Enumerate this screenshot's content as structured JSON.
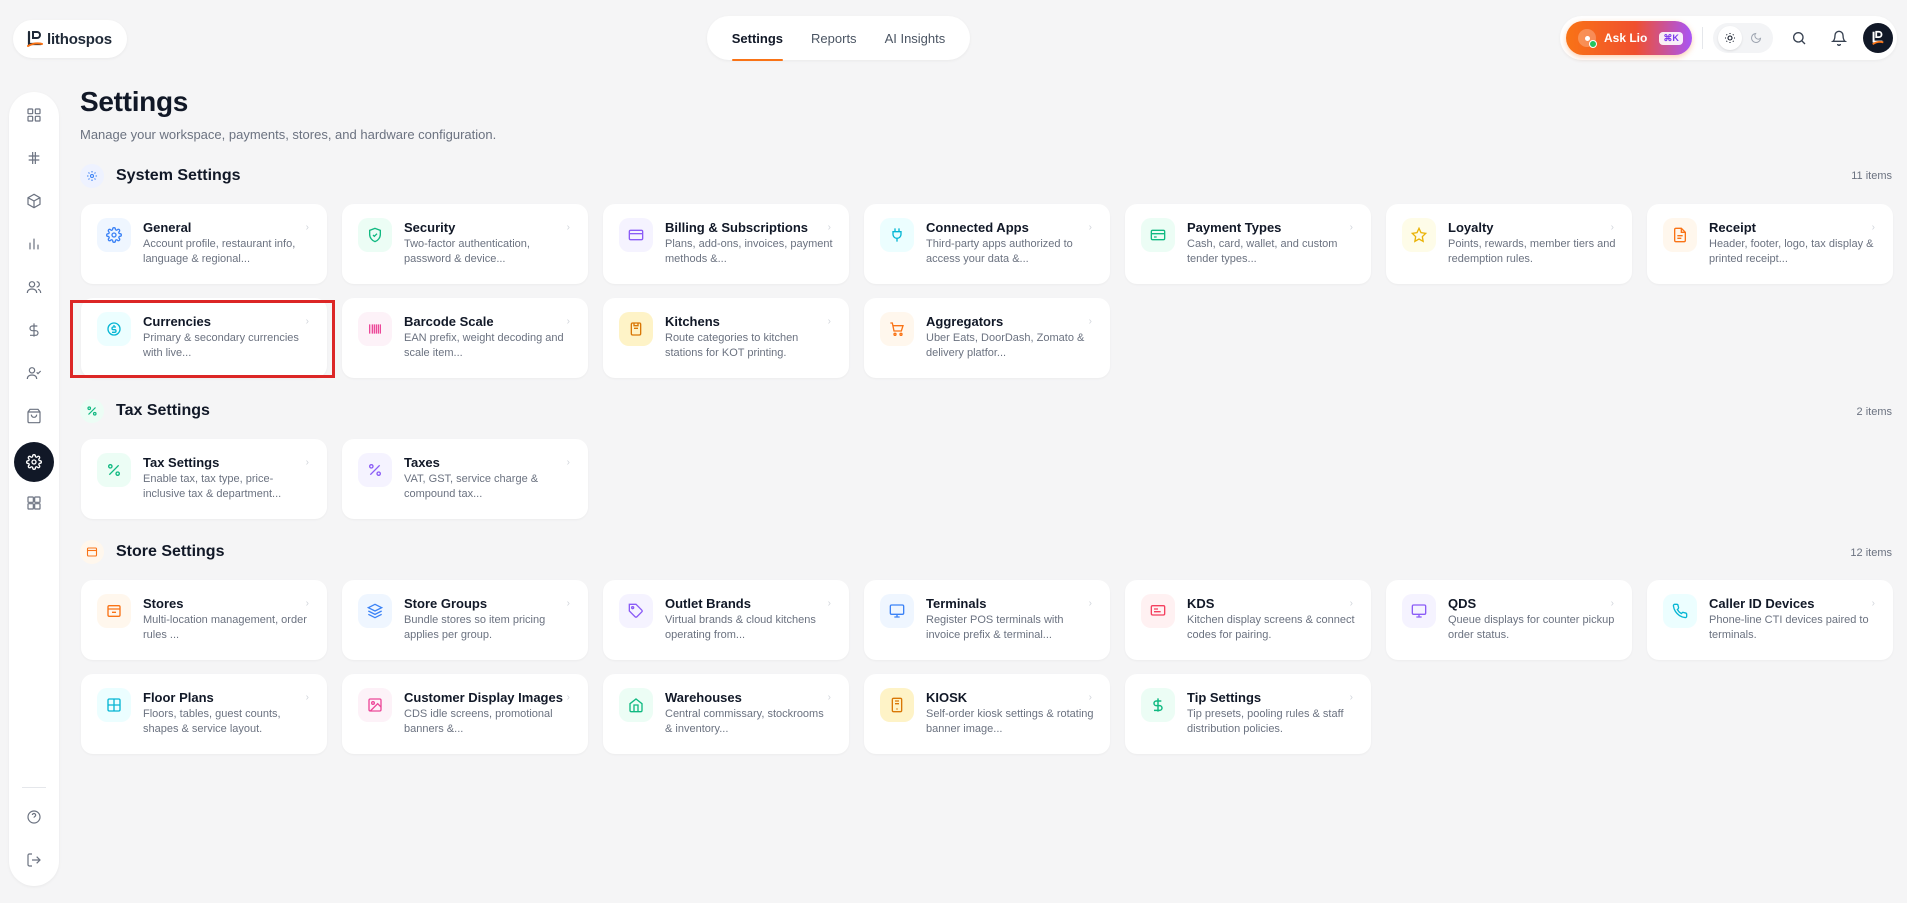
{
  "app": {
    "logo_text": "lithospos"
  },
  "topnav": {
    "items": [
      {
        "label": "Settings",
        "active": true
      },
      {
        "label": "Reports",
        "active": false
      },
      {
        "label": "AI Insights",
        "active": false
      }
    ]
  },
  "topright": {
    "ask_label": "Ask Lio",
    "ask_shortcut": "⌘K"
  },
  "page": {
    "title": "Settings",
    "subtitle": "Manage your workspace, payments, stores, and hardware configuration."
  },
  "sections": {
    "system": {
      "title": "System Settings",
      "count": "11 items"
    },
    "tax": {
      "title": "Tax Settings",
      "count": "2 items"
    },
    "store": {
      "title": "Store Settings",
      "count": "12 items"
    }
  },
  "cards": {
    "general": {
      "title": "General",
      "desc": "Account profile, restaurant info, language & regional..."
    },
    "security": {
      "title": "Security",
      "desc": "Two-factor authentication, password & device..."
    },
    "billing": {
      "title": "Billing & Subscriptions",
      "desc": "Plans, add-ons, invoices, payment methods &..."
    },
    "connected": {
      "title": "Connected Apps",
      "desc": "Third-party apps authorized to access your data &..."
    },
    "payment": {
      "title": "Payment Types",
      "desc": "Cash, card, wallet, and custom tender types..."
    },
    "loyalty": {
      "title": "Loyalty",
      "desc": "Points, rewards, member tiers and redemption rules."
    },
    "receipt": {
      "title": "Receipt",
      "desc": "Header, footer, logo, tax display & printed receipt..."
    },
    "currencies": {
      "title": "Currencies",
      "desc": "Primary & secondary currencies with live..."
    },
    "barcode": {
      "title": "Barcode Scale",
      "desc": "EAN prefix, weight decoding and scale item..."
    },
    "kitchens": {
      "title": "Kitchens",
      "desc": "Route categories to kitchen stations for KOT printing."
    },
    "aggregators": {
      "title": "Aggregators",
      "desc": "Uber Eats, DoorDash, Zomato & delivery platfor..."
    },
    "taxsettings": {
      "title": "Tax Settings",
      "desc": "Enable tax, tax type, price-inclusive tax & department..."
    },
    "taxes": {
      "title": "Taxes",
      "desc": "VAT, GST, service charge & compound tax..."
    },
    "stores": {
      "title": "Stores",
      "desc": "Multi-location management, order rules ..."
    },
    "storegroups": {
      "title": "Store Groups",
      "desc": "Bundle stores so item pricing applies per group."
    },
    "outlet": {
      "title": "Outlet Brands",
      "desc": "Virtual brands & cloud kitchens operating from..."
    },
    "terminals": {
      "title": "Terminals",
      "desc": "Register POS terminals with invoice prefix & terminal..."
    },
    "kds": {
      "title": "KDS",
      "desc": "Kitchen display screens & connect codes for pairing."
    },
    "qds": {
      "title": "QDS",
      "desc": "Queue displays for counter pickup order status."
    },
    "callerid": {
      "title": "Caller ID Devices",
      "desc": "Phone-line CTI devices paired to terminals."
    },
    "floor": {
      "title": "Floor Plans",
      "desc": "Floors, tables, guest counts, shapes & service layout."
    },
    "customerdisplay": {
      "title": "Customer Display Images",
      "desc": "CDS idle screens, promotional banners &..."
    },
    "warehouses": {
      "title": "Warehouses",
      "desc": "Central commissary, stockrooms & inventory..."
    },
    "kiosk": {
      "title": "KIOSK",
      "desc": "Self-order kiosk settings & rotating banner image..."
    },
    "tip": {
      "title": "Tip Settings",
      "desc": "Tip presets, pooling rules & staff distribution policies."
    }
  }
}
